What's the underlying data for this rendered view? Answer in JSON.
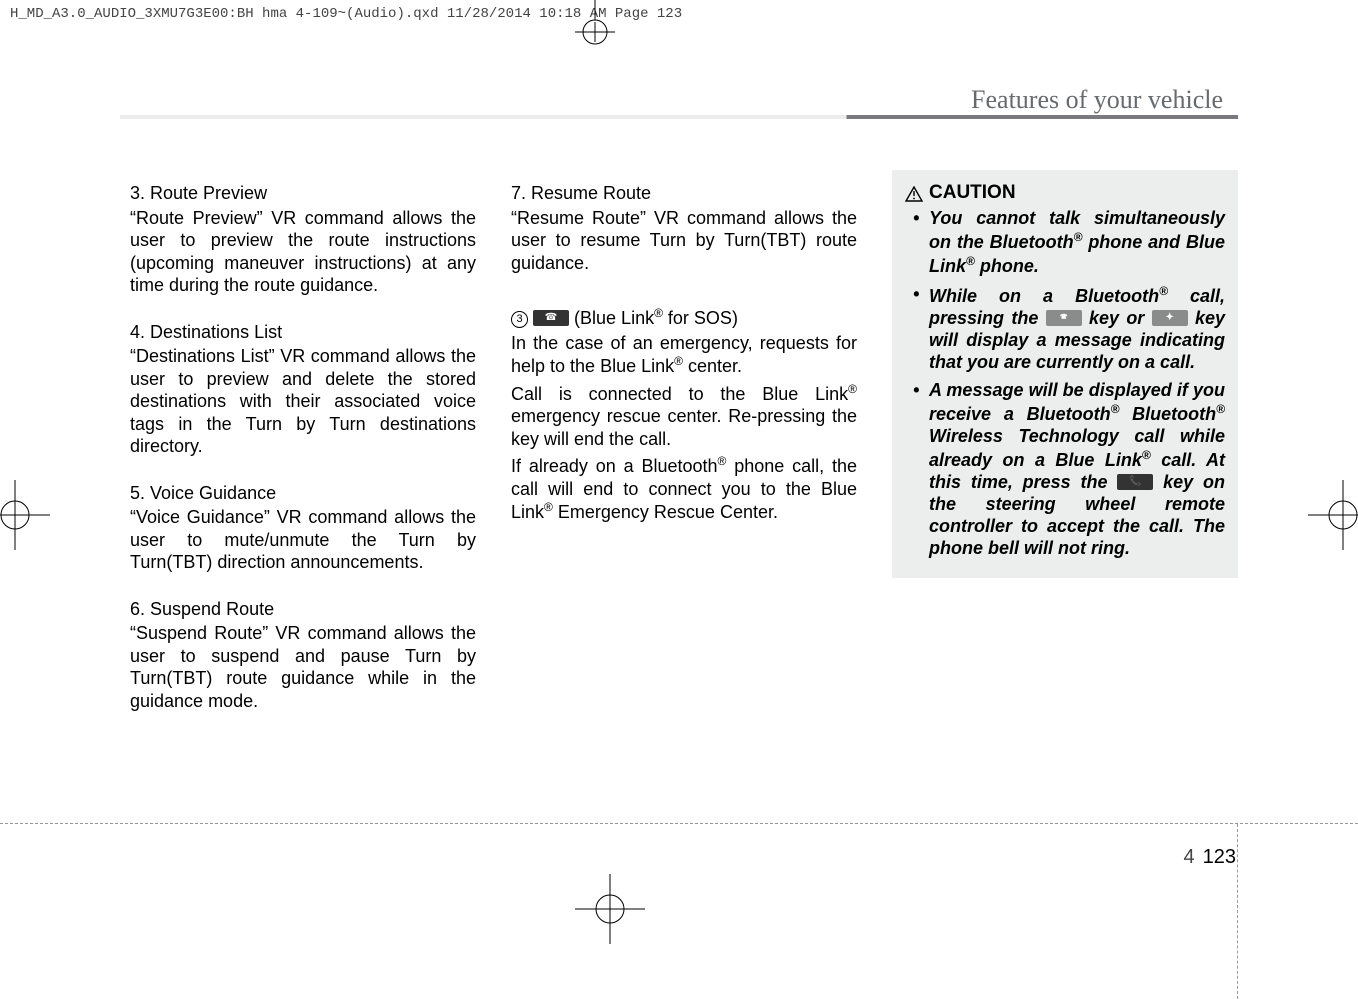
{
  "meta": {
    "headerline": "H_MD_A3.0_AUDIO_3XMU7G3E00:BH hma 4-109~(Audio).qxd  11/28/2014  10:18 AM  Page 123"
  },
  "section_title": "Features of your vehicle",
  "col1": {
    "h3": "3. Route Preview",
    "p3": "“Route Preview” VR command allows the user to preview the route instructions (upcoming maneuver instructions) at any time during the route guidance.",
    "h4": "4. Destinations List",
    "p4": "“Destinations List” VR command allows the user to preview and delete the stored destinations with their associated voice tags in the Turn by Turn destinations directory.",
    "h5": "5. Voice Guidance",
    "p5": "“Voice Guidance” VR command allows the user to mute/unmute the Turn by Turn(TBT) direction announcements.",
    "h6": "6. Suspend Route",
    "p6": "“Suspend Route” VR command allows the user to suspend and pause Turn by Turn(TBT) route guidance while in the guidance mode."
  },
  "col2": {
    "h7": "7. Resume Route",
    "p7": "“Resume Route” VR command allows the user to resume Turn by Turn(TBT) route guidance.",
    "item3_num": "3",
    "bluelabel": " (Blue Link",
    "bluelabel2": " for SOS)",
    "p8": "In the case of an emergency, requests for help to the Blue Link",
    "p8b": " center.",
    "p9": "Call is connected to the Blue Link",
    "p9b": " emergency rescue center. Re-pressing the key will end the call.",
    "p10a": "If already on a Bluetooth",
    "p10b": " phone call, the call will end to connect you to the Blue Link",
    "p10c": " Emergency Rescue Center."
  },
  "caution": {
    "title": "CAUTION",
    "b1a": "You cannot talk simultaneously on the Bluetooth",
    "b1b": " phone and Blue Link",
    "b1c": " phone.",
    "b2a": "While on a Bluetooth",
    "b2b": " call, pressing the ",
    "b2c": " key or ",
    "b2d": " key will display a message indicating that you are currently on a call.",
    "b3a": "A message will be displayed if you receive a Bluetooth",
    "b3b": " Bluetooth",
    "b3c": " Wireless Technology call while already on a Blue Link",
    "b3d": " call. At this time, press the ",
    "b3e": " key on the steering wheel remote controller to accept the call. The phone bell will not ring."
  },
  "pagenum": {
    "chap": "4",
    "page": "123"
  },
  "reg": "®"
}
